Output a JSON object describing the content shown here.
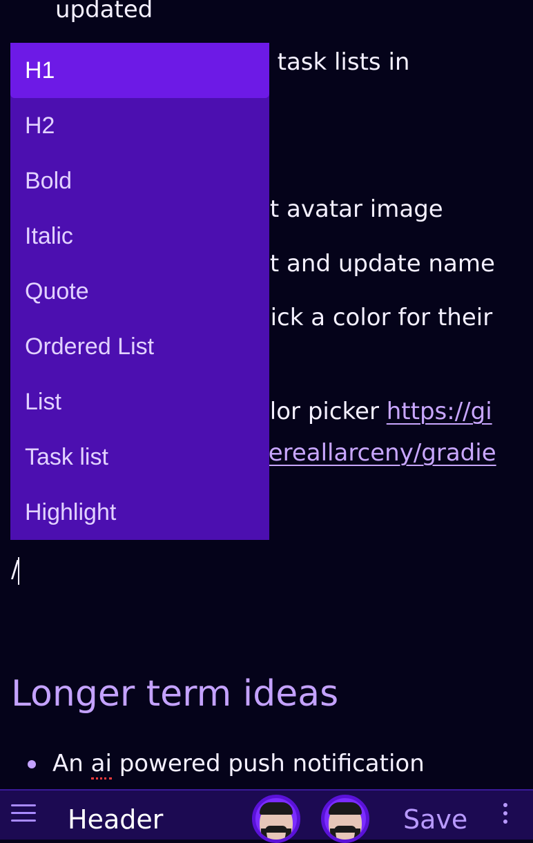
{
  "document": {
    "lines": [
      "updated",
      "o task lists in",
      "et avatar image",
      "et and update name",
      "pick a color for their",
      "olor picker "
    ],
    "links": [
      "https://gi",
      "cereallarceny/gradie"
    ],
    "slash_input": "/",
    "section_heading": "Longer term ideas",
    "bullet_prefix": "An ",
    "bullet_misspelled": "ai",
    "bullet_suffix": " powered push notification"
  },
  "slash_menu": {
    "items": [
      "H1",
      "H2",
      "Bold",
      "Italic",
      "Quote",
      "Ordered List",
      "List",
      "Task list",
      "Highlight"
    ],
    "selected": "H1"
  },
  "bottom_bar": {
    "menu_icon": "hamburger-icon",
    "title": "Header",
    "save_label": "Save",
    "more_icon": "kebab-icon"
  },
  "colors": {
    "background": "#05031a",
    "menu_bg": "#4c0fb0",
    "menu_selected": "#6d1ae6",
    "accent": "#c4a2ff",
    "bar_bg": "#1c0a52"
  }
}
